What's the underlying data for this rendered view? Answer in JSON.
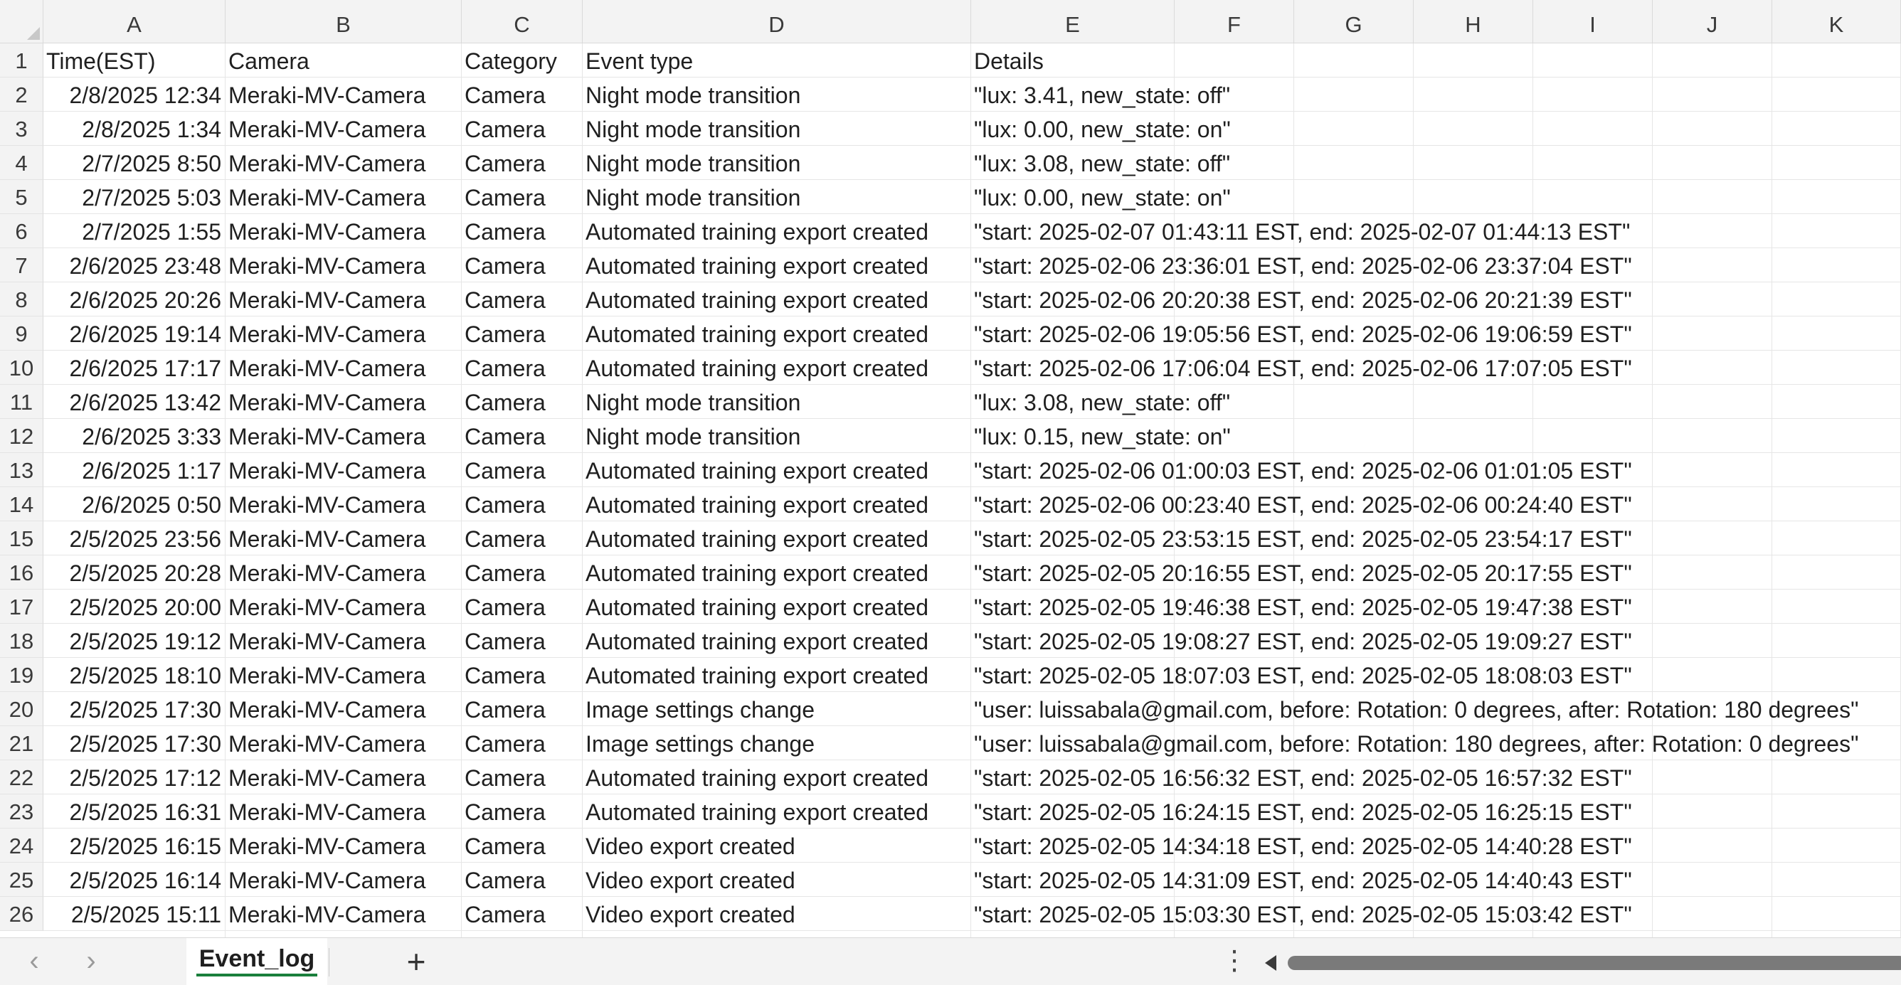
{
  "columns": [
    "A",
    "B",
    "C",
    "D",
    "E",
    "F",
    "G",
    "H",
    "I",
    "J",
    "K"
  ],
  "header": {
    "A": "Time(EST)",
    "B": "Camera",
    "C": "Category",
    "D": "Event type",
    "E": "Details"
  },
  "rows": [
    {
      "time": "2/8/2025 12:34",
      "camera": "Meraki-MV-Camera",
      "category": "Camera",
      "event": "Night mode transition",
      "details": "\"lux:   3.41, new_state: off\""
    },
    {
      "time": "2/8/2025 1:34",
      "camera": "Meraki-MV-Camera",
      "category": "Camera",
      "event": "Night mode transition",
      "details": "\"lux:   0.00, new_state: on\""
    },
    {
      "time": "2/7/2025 8:50",
      "camera": "Meraki-MV-Camera",
      "category": "Camera",
      "event": "Night mode transition",
      "details": "\"lux:   3.08, new_state: off\""
    },
    {
      "time": "2/7/2025 5:03",
      "camera": "Meraki-MV-Camera",
      "category": "Camera",
      "event": "Night mode transition",
      "details": "\"lux:   0.00, new_state: on\""
    },
    {
      "time": "2/7/2025 1:55",
      "camera": "Meraki-MV-Camera",
      "category": "Camera",
      "event": "Automated training export created",
      "details": "\"start: 2025-02-07 01:43:11 EST, end: 2025-02-07 01:44:13 EST\""
    },
    {
      "time": "2/6/2025 23:48",
      "camera": "Meraki-MV-Camera",
      "category": "Camera",
      "event": "Automated training export created",
      "details": "\"start: 2025-02-06 23:36:01 EST, end: 2025-02-06 23:37:04 EST\""
    },
    {
      "time": "2/6/2025 20:26",
      "camera": "Meraki-MV-Camera",
      "category": "Camera",
      "event": "Automated training export created",
      "details": "\"start: 2025-02-06 20:20:38 EST, end: 2025-02-06 20:21:39 EST\""
    },
    {
      "time": "2/6/2025 19:14",
      "camera": "Meraki-MV-Camera",
      "category": "Camera",
      "event": "Automated training export created",
      "details": "\"start: 2025-02-06 19:05:56 EST, end: 2025-02-06 19:06:59 EST\""
    },
    {
      "time": "2/6/2025 17:17",
      "camera": "Meraki-MV-Camera",
      "category": "Camera",
      "event": "Automated training export created",
      "details": "\"start: 2025-02-06 17:06:04 EST, end: 2025-02-06 17:07:05 EST\""
    },
    {
      "time": "2/6/2025 13:42",
      "camera": "Meraki-MV-Camera",
      "category": "Camera",
      "event": "Night mode transition",
      "details": "\"lux:   3.08, new_state: off\""
    },
    {
      "time": "2/6/2025 3:33",
      "camera": "Meraki-MV-Camera",
      "category": "Camera",
      "event": "Night mode transition",
      "details": "\"lux:   0.15, new_state: on\""
    },
    {
      "time": "2/6/2025 1:17",
      "camera": "Meraki-MV-Camera",
      "category": "Camera",
      "event": "Automated training export created",
      "details": "\"start: 2025-02-06 01:00:03 EST, end: 2025-02-06 01:01:05 EST\""
    },
    {
      "time": "2/6/2025 0:50",
      "camera": "Meraki-MV-Camera",
      "category": "Camera",
      "event": "Automated training export created",
      "details": "\"start: 2025-02-06 00:23:40 EST, end: 2025-02-06 00:24:40 EST\""
    },
    {
      "time": "2/5/2025 23:56",
      "camera": "Meraki-MV-Camera",
      "category": "Camera",
      "event": "Automated training export created",
      "details": "\"start: 2025-02-05 23:53:15 EST, end: 2025-02-05 23:54:17 EST\""
    },
    {
      "time": "2/5/2025 20:28",
      "camera": "Meraki-MV-Camera",
      "category": "Camera",
      "event": "Automated training export created",
      "details": "\"start: 2025-02-05 20:16:55 EST, end: 2025-02-05 20:17:55 EST\""
    },
    {
      "time": "2/5/2025 20:00",
      "camera": "Meraki-MV-Camera",
      "category": "Camera",
      "event": "Automated training export created",
      "details": "\"start: 2025-02-05 19:46:38 EST, end: 2025-02-05 19:47:38 EST\""
    },
    {
      "time": "2/5/2025 19:12",
      "camera": "Meraki-MV-Camera",
      "category": "Camera",
      "event": "Automated training export created",
      "details": "\"start: 2025-02-05 19:08:27 EST, end: 2025-02-05 19:09:27 EST\""
    },
    {
      "time": "2/5/2025 18:10",
      "camera": "Meraki-MV-Camera",
      "category": "Camera",
      "event": "Automated training export created",
      "details": "\"start: 2025-02-05 18:07:03 EST, end: 2025-02-05 18:08:03 EST\""
    },
    {
      "time": "2/5/2025 17:30",
      "camera": "Meraki-MV-Camera",
      "category": "Camera",
      "event": "Image settings change",
      "details": "\"user: luissabala@gmail.com, before: Rotation: 0 degrees, after: Rotation: 180 degrees\""
    },
    {
      "time": "2/5/2025 17:30",
      "camera": "Meraki-MV-Camera",
      "category": "Camera",
      "event": "Image settings change",
      "details": "\"user: luissabala@gmail.com, before: Rotation: 180 degrees, after: Rotation: 0 degrees\""
    },
    {
      "time": "2/5/2025 17:12",
      "camera": "Meraki-MV-Camera",
      "category": "Camera",
      "event": "Automated training export created",
      "details": "\"start: 2025-02-05 16:56:32 EST, end: 2025-02-05 16:57:32 EST\""
    },
    {
      "time": "2/5/2025 16:31",
      "camera": "Meraki-MV-Camera",
      "category": "Camera",
      "event": "Automated training export created",
      "details": "\"start: 2025-02-05 16:24:15 EST, end: 2025-02-05 16:25:15 EST\""
    },
    {
      "time": "2/5/2025 16:15",
      "camera": "Meraki-MV-Camera",
      "category": "Camera",
      "event": "Video export created",
      "details": "\"start: 2025-02-05 14:34:18 EST, end: 2025-02-05 14:40:28 EST\""
    },
    {
      "time": "2/5/2025 16:14",
      "camera": "Meraki-MV-Camera",
      "category": "Camera",
      "event": "Video export created",
      "details": "\"start: 2025-02-05 14:31:09 EST, end: 2025-02-05 14:40:43 EST\""
    },
    {
      "time": "2/5/2025 15:11",
      "camera": "Meraki-MV-Camera",
      "category": "Camera",
      "event": "Video export created",
      "details": "\"start: 2025-02-05 15:03:30 EST, end: 2025-02-05 15:03:42 EST\""
    }
  ],
  "tabs": {
    "sheet_name": "Event_log",
    "prev_icon": "chevron-left-icon",
    "next_icon": "chevron-right-icon",
    "add_icon": "plus-icon",
    "more_icon": "vertical-ellipsis-icon"
  },
  "colors": {
    "active_tab_underline": "#1a7f3c",
    "header_bg": "#f3f3f3",
    "gridline": "#e6e6e6"
  }
}
